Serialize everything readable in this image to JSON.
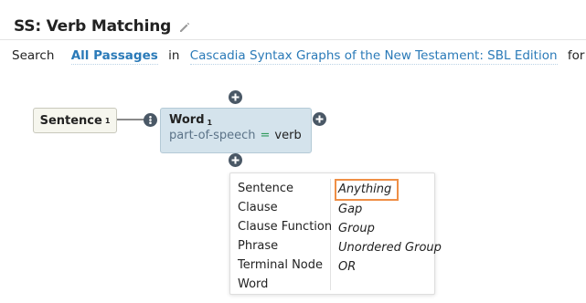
{
  "header": {
    "title": "SS: Verb Matching",
    "edit_icon": "pencil-icon"
  },
  "search_bar": {
    "search_label": "Search",
    "scope": "All Passages",
    "in_label": "in",
    "resource": "Cascadia Syntax Graphs of the New Testament: SBL Edition",
    "for_label": "for"
  },
  "query": {
    "sentence_node": {
      "label": "Sentence",
      "index": "1"
    },
    "word_node": {
      "label": "Word",
      "index": "1",
      "constraint": {
        "property": "part-of-speech",
        "operator": "=",
        "value": "verb"
      }
    }
  },
  "add_menu": {
    "left_column": [
      "Sentence",
      "Clause",
      "Clause Function",
      "Phrase",
      "Terminal Node",
      "Word"
    ],
    "right_column": [
      "Anything",
      "Gap",
      "Group",
      "Unordered Group",
      "OR"
    ],
    "highlighted": "Anything"
  },
  "colors": {
    "link": "#2a7ab8",
    "word_node_bg": "#d4e3ec",
    "sentence_node_bg": "#f6f6ee",
    "highlight_outline": "#ef8f46",
    "icon_button": "#4a5866",
    "operator": "#2e9a5b"
  }
}
